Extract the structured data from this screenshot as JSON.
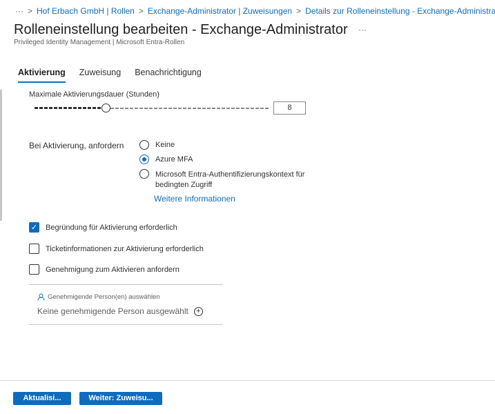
{
  "breadcrumb": {
    "more": "···",
    "items": [
      "Hof Erbach GmbH | Rollen",
      "Exchange-Administrator | Zuweisungen",
      "Details zur Rolleneinstellung - Exchange-Administrator"
    ],
    "sep": ">"
  },
  "title": "Rolleneinstellung bearbeiten - Exchange-Administrator",
  "title_more": "···",
  "subtitle": "Privileged Identity Management | Microsoft Entra-Rollen",
  "tabs": [
    {
      "label": "Aktivierung",
      "active": true
    },
    {
      "label": "Zuweisung"
    },
    {
      "label": "Benachrichtigung"
    }
  ],
  "duration": {
    "label": "Maximale Aktivierungsdauer (Stunden)",
    "value": "8",
    "fraction": 0.304
  },
  "require": {
    "label": "Bei Aktivierung, anfordern",
    "options": [
      "Keine",
      "Azure MFA",
      "Microsoft Entra-Authentifizierungskontext für",
      "bedingten Zugriff"
    ],
    "selected": 1,
    "link": "Weitere Informationen"
  },
  "checkboxes": [
    {
      "label": "Begründung für Aktivierung erforderlich",
      "checked": true
    },
    {
      "label": "Ticketinformationen zur Aktivierung erforderlich",
      "checked": false
    },
    {
      "label": "Genehmigung zum Aktivieren anfordern",
      "checked": false
    }
  ],
  "approver": {
    "label": "Genehmigende Person(en) auswählen",
    "value": "Keine genehmigende Person ausgewählt"
  },
  "buttons": {
    "update": "Aktualisi...",
    "next": "Weiter: Zuweisu..."
  },
  "check_mark": "✓",
  "plus": "+"
}
